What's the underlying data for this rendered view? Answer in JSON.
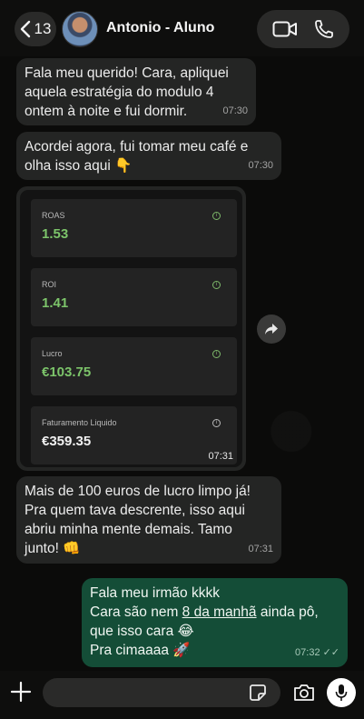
{
  "header": {
    "back_count": "13",
    "contact_name": "Antonio - Aluno"
  },
  "messages": [
    {
      "direction": "in",
      "lines": [
        "Fala meu querido! Cara, apliquei",
        "aquela estratégia do modulo 4",
        "ontem à noite e fui dormir."
      ],
      "time": "07:30"
    },
    {
      "direction": "in",
      "lines": [
        "Acordei agora, fui tomar meu café e",
        "olha isso aqui 👇"
      ],
      "time": "07:30"
    },
    {
      "direction": "in",
      "type": "image",
      "time": "07:31",
      "metrics": [
        {
          "label": "ROAS",
          "value": "1.53",
          "color": "#7cc46a"
        },
        {
          "label": "ROI",
          "value": "1.41",
          "color": "#7cc46a"
        },
        {
          "label": "Lucro",
          "value": "€103.75",
          "color": "#7cc46a"
        },
        {
          "label": "Faturamento Liquido",
          "value": "€359.35",
          "color": "#f1f1f1"
        }
      ]
    },
    {
      "direction": "in",
      "lines": [
        "Mais de 100 euros de lucro limpo já!",
        "Pra quem tava descrente, isso aqui",
        "abriu minha mente demais. Tamo",
        "junto! 👊"
      ],
      "time": "07:31"
    },
    {
      "direction": "out",
      "lines": [
        "Fala meu irmão kkkk",
        "Cara são nem ",
        "8 da manhã",
        " ainda pô,",
        "que isso cara 😂",
        "Pra cimaaaa 🚀"
      ],
      "time": "07:32"
    }
  ],
  "composer": {
    "placeholder": ""
  },
  "colors": {
    "incoming_bubble": "#242524",
    "outgoing_bubble": "#144d37",
    "metric_green": "#7cc46a"
  }
}
